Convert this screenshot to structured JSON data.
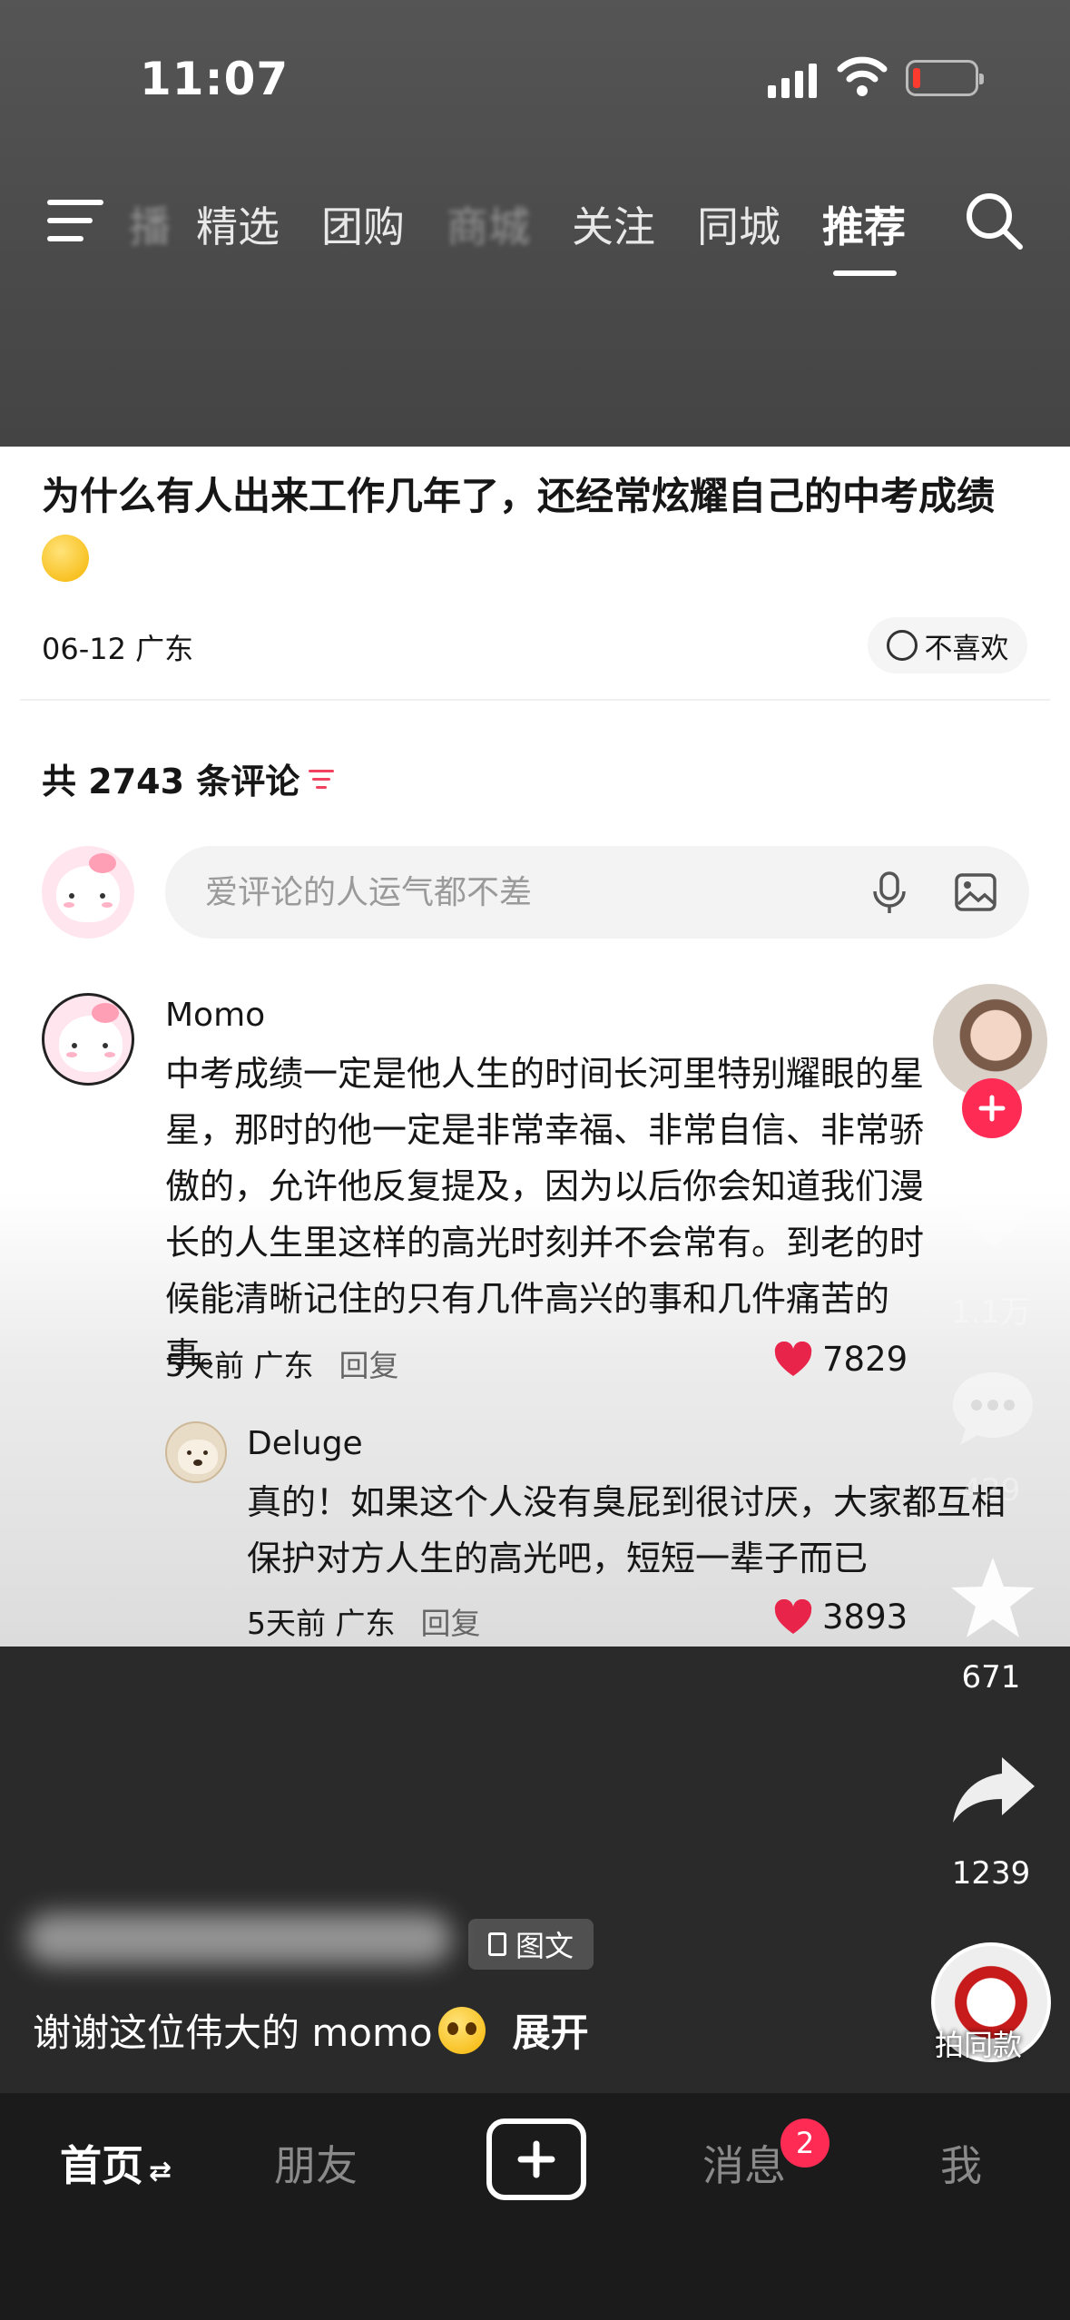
{
  "status_bar": {
    "time": "11:07"
  },
  "top_nav": {
    "tabs": [
      {
        "label": "播",
        "state": "faded"
      },
      {
        "label": "精选",
        "state": "normal"
      },
      {
        "label": "团购",
        "state": "normal"
      },
      {
        "label": "商城",
        "state": "faded"
      },
      {
        "label": "关注",
        "state": "normal"
      },
      {
        "label": "同城",
        "state": "normal"
      },
      {
        "label": "推荐",
        "state": "active"
      }
    ],
    "menu_icon": "hamburger-icon",
    "search_icon": "search-icon"
  },
  "post": {
    "title": "为什么有人出来工作几年了，还经常炫耀自己的中考成绩",
    "date": "06-12",
    "location": "广东",
    "dislike_label": "不喜欢"
  },
  "comments_header": {
    "prefix": "共",
    "count": "2743",
    "suffix": "条评论"
  },
  "comment_input": {
    "placeholder": "爱评论的人运气都不差"
  },
  "comments": [
    {
      "author": "Momo",
      "text": "中考成绩一定是他人生的时间长河里特别耀眼的星星，那时的他一定是非常幸福、非常自信、非常骄傲的，允许他反复提及，因为以后你会知道我们漫长的人生里这样的高光时刻并不会常有。到老的时候能清晰记住的只有几件高兴的事和几件痛苦的事。",
      "time": "5天前",
      "location": "广东",
      "reply_label": "回复",
      "likes": "7829"
    },
    {
      "author": "Deluge",
      "text": "真的！如果这个人没有臭屁到很讨厌，大家都互相保护对方人生的高光吧，短短一辈子而已",
      "time": "5天前",
      "location": "广东",
      "reply_label": "回复",
      "likes": "3893"
    }
  ],
  "side_actions": {
    "likes": "1.1万",
    "comments": "429",
    "favorites": "671",
    "shares": "1239",
    "music_label": "拍同款"
  },
  "caption": {
    "tag": "图文",
    "text": "谢谢这位伟大的 momo",
    "expand": "展开"
  },
  "tabbar": {
    "home": "首页",
    "friends": "朋友",
    "messages": "消息",
    "messages_badge": "2",
    "me": "我"
  },
  "colors": {
    "accent": "#fe2c55",
    "heart": "#e8244a"
  }
}
